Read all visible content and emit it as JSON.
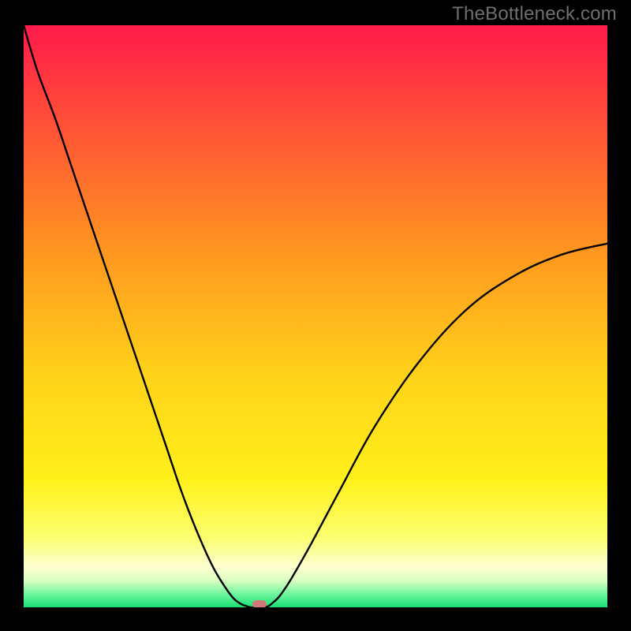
{
  "watermark": {
    "text": "TheBottleneck.com"
  },
  "chart_data": {
    "type": "line",
    "title": "",
    "xlabel": "",
    "ylabel": "",
    "xlim": [
      0,
      100
    ],
    "ylim": [
      0,
      100
    ],
    "grid": false,
    "legend": false,
    "gradient_stops": [
      {
        "offset": 0.0,
        "color": "#ff1a4a"
      },
      {
        "offset": 0.2,
        "color": "#ff5a33"
      },
      {
        "offset": 0.4,
        "color": "#ff9a1f"
      },
      {
        "offset": 0.6,
        "color": "#ffd21a"
      },
      {
        "offset": 0.78,
        "color": "#fff01a"
      },
      {
        "offset": 0.88,
        "color": "#fbff6e"
      },
      {
        "offset": 0.93,
        "color": "#fdffd0"
      },
      {
        "offset": 0.955,
        "color": "#d9ffc2"
      },
      {
        "offset": 0.975,
        "color": "#77f7a1"
      },
      {
        "offset": 1.0,
        "color": "#19e075"
      }
    ],
    "series": [
      {
        "name": "bottleneck-left",
        "x": [
          0.0,
          2.4,
          5.4,
          8.1,
          10.8,
          13.5,
          16.2,
          18.9,
          21.6,
          24.3,
          27.0,
          29.7,
          32.4,
          34.5,
          36.0,
          37.2,
          38.2,
          38.9,
          39.6
        ],
        "y": [
          100.0,
          92.0,
          84.0,
          76.0,
          68.0,
          60.0,
          52.0,
          44.0,
          36.0,
          28.0,
          20.0,
          13.0,
          7.0,
          3.5,
          1.5,
          0.6,
          0.2,
          0.0,
          0.0
        ]
      },
      {
        "name": "bottleneck-right",
        "x": [
          41.2,
          41.9,
          42.7,
          43.9,
          45.9,
          49.3,
          54.1,
          60.1,
          67.6,
          75.7,
          83.8,
          91.9,
          100.0
        ],
        "y": [
          0.0,
          0.2,
          0.8,
          2.0,
          5.0,
          11.0,
          20.0,
          31.0,
          42.0,
          51.0,
          56.8,
          60.5,
          62.5
        ]
      }
    ],
    "marker": {
      "x": 40.4,
      "y": 0.0,
      "color": "#cf7a78"
    }
  }
}
